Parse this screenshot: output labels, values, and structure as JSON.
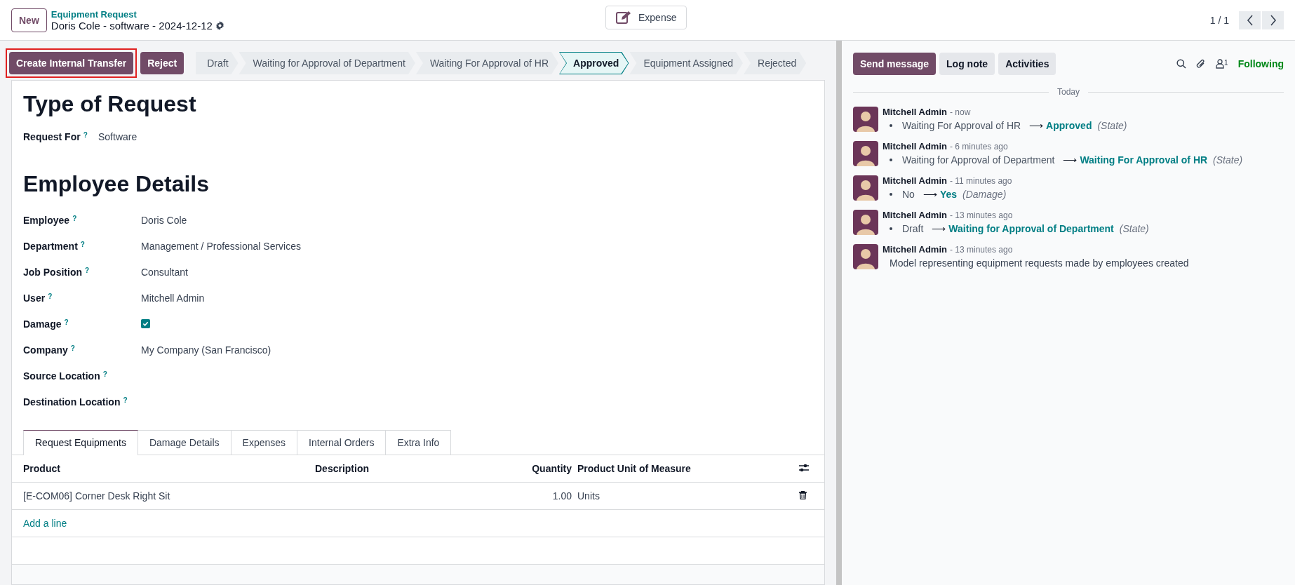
{
  "top_bar": {
    "new_button": "New",
    "breadcrumb": "Equipment Request",
    "record_title": "Doris Cole - software - 2024-12-12",
    "smart_button": "Expense",
    "pager": "1 / 1"
  },
  "actions": [
    {
      "label": "Create Internal Transfer",
      "highlighted": true
    },
    {
      "label": "Reject",
      "highlighted": false
    }
  ],
  "stages": [
    {
      "label": "Draft",
      "selected": false
    },
    {
      "label": "Waiting for Approval of Department",
      "selected": false
    },
    {
      "label": "Waiting For Approval of HR",
      "selected": false
    },
    {
      "label": "Approved",
      "selected": true
    },
    {
      "label": "Equipment Assigned",
      "selected": false
    },
    {
      "label": "Rejected",
      "selected": false
    }
  ],
  "sections": [
    {
      "title": "Type of Request",
      "fields": [
        {
          "label": "Request For",
          "help": "?",
          "kind": "text",
          "value": "Software"
        }
      ]
    },
    {
      "title": "Employee Details",
      "fields": [
        {
          "label": "Employee",
          "help": "?",
          "kind": "text",
          "value": "Doris Cole"
        },
        {
          "label": "Department",
          "help": "?",
          "kind": "text",
          "value": "Management / Professional Services"
        },
        {
          "label": "Job Position",
          "help": "?",
          "kind": "text",
          "value": "Consultant"
        },
        {
          "label": "User",
          "help": "?",
          "kind": "text",
          "value": "Mitchell Admin"
        },
        {
          "label": "Damage",
          "help": "?",
          "kind": "checkbox",
          "checked": true
        },
        {
          "label": "Company",
          "help": "?",
          "kind": "text",
          "value": "My Company (San Francisco)"
        },
        {
          "label": "Source Location",
          "help": "?",
          "kind": "text"
        },
        {
          "label": "Destination Location",
          "help": "?",
          "kind": "text"
        }
      ]
    }
  ],
  "tabs": [
    {
      "label": "Request Equipments",
      "selected": true
    },
    {
      "label": "Damage Details",
      "selected": false
    },
    {
      "label": "Expenses",
      "selected": false
    },
    {
      "label": "Internal Orders",
      "selected": false
    },
    {
      "label": "Extra Info",
      "selected": false
    }
  ],
  "table": {
    "columns": [
      "Product",
      "Description",
      "Quantity",
      "Product Unit of Measure"
    ],
    "rows": [
      {
        "product": "[E-COM06] Corner Desk Right Sit",
        "description": "",
        "quantity": "1.00",
        "uom": "Units"
      }
    ],
    "add_line": "Add a line"
  },
  "chatter": {
    "buttons": [
      {
        "label": "Send message",
        "selected": true
      },
      {
        "label": "Log note",
        "selected": false
      },
      {
        "label": "Activities",
        "selected": false
      }
    ],
    "followers_count": "1",
    "following": "Following",
    "date_separator": "Today",
    "messages": [
      {
        "author": "Mitchell Admin",
        "time": "- now",
        "kind": "tracking",
        "old": "Waiting For Approval of HR",
        "arrow": "⟶",
        "new": "Approved",
        "field": "(State)"
      },
      {
        "author": "Mitchell Admin",
        "time": "- 6 minutes ago",
        "kind": "tracking",
        "old": "Waiting for Approval of Department",
        "arrow": "⟶",
        "new": "Waiting For Approval of HR",
        "field": "(State)"
      },
      {
        "author": "Mitchell Admin",
        "time": "- 11 minutes ago",
        "kind": "tracking",
        "old": "No",
        "arrow": "⟶",
        "new": "Yes",
        "field": "(Damage)"
      },
      {
        "author": "Mitchell Admin",
        "time": "- 13 minutes ago",
        "kind": "tracking",
        "old": "Draft",
        "arrow": "⟶",
        "new": "Waiting for Approval of Department",
        "field": "(State)"
      },
      {
        "author": "Mitchell Admin",
        "time": "- 13 minutes ago",
        "kind": "note",
        "body": "Model representing equipment requests made by employees created"
      }
    ]
  }
}
